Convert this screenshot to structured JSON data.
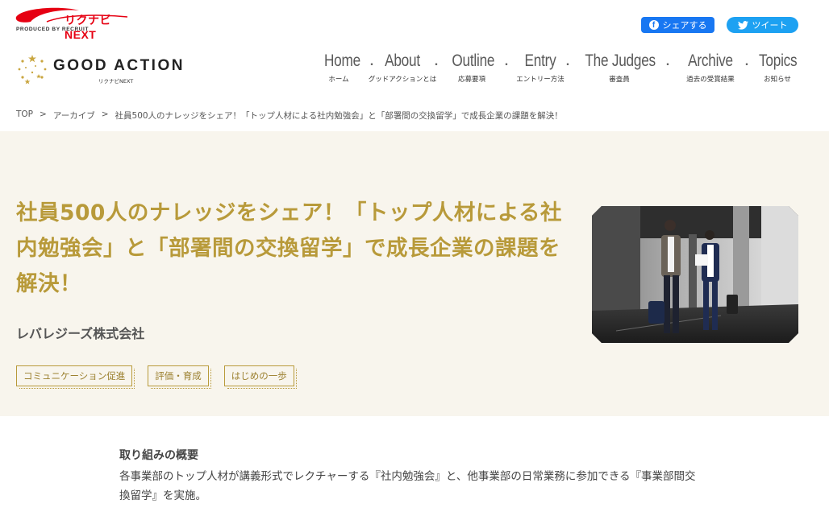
{
  "header": {
    "rikunabi_logo": "リクナビNEXT",
    "rikunabi_produced_by": "PRODUCED BY RECRUIT",
    "share_facebook": "シェアする",
    "share_twitter": "ツイート",
    "site_logo_title": "GOOD ACTION",
    "site_logo_sub": "リクナビNEXT"
  },
  "nav": [
    {
      "en": "Home",
      "jp": "ホーム"
    },
    {
      "en": "About",
      "jp": "グッドアクションとは"
    },
    {
      "en": "Outline",
      "jp": "応募要項"
    },
    {
      "en": "Entry",
      "jp": "エントリー方法"
    },
    {
      "en": "The Judges",
      "jp": "審査員"
    },
    {
      "en": "Archive",
      "jp": "過去の受賞結果"
    },
    {
      "en": "Topics",
      "jp": "お知らせ"
    }
  ],
  "breadcrumb": {
    "top": "TOP",
    "sep": ">",
    "archive": "アーカイブ",
    "current": "社員500人のナレッジをシェア！「トップ人材による社内勉強会」と「部署間の交換留学」で成長企業の課題を解決！"
  },
  "hero": {
    "title": "社員500人のナレッジをシェア！「トップ人材による社内勉強会」と「部署間の交換留学」で成長企業の課題を解決！",
    "company": "レバレジーズ株式会社",
    "tags": [
      "コミュニケーション促進",
      "評価・育成",
      "はじめの一歩"
    ]
  },
  "overview": {
    "heading": "取り組みの概要",
    "body": "各事業部のトップ人材が講義形式でレクチャーする『社内勉強会』と、他事業部の日常業務に参加できる『事業部間交換留学』を実施。"
  },
  "colors": {
    "accent_gold": "#b89a3a",
    "hero_bg": "#f8f5ed",
    "facebook": "#1877f2",
    "twitter": "#1da1f2",
    "rikunabi_red": "#e60012"
  }
}
